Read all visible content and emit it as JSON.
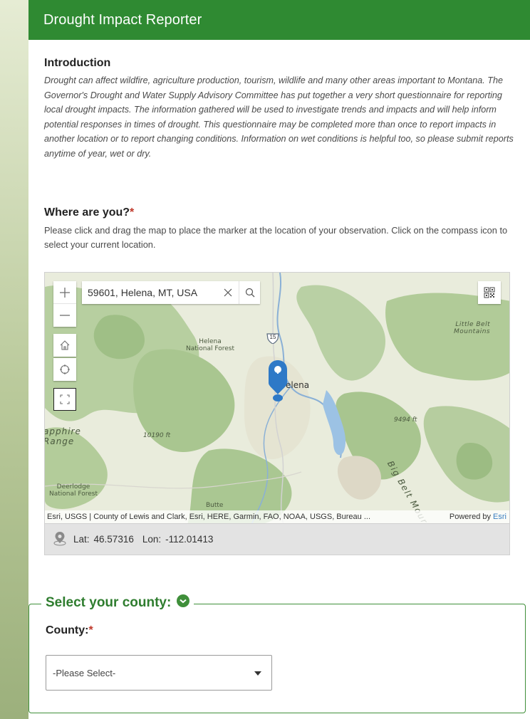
{
  "header": {
    "title": "Drought Impact Reporter",
    "bg_color": "#2f8a32"
  },
  "introduction": {
    "heading": "Introduction",
    "body": "Drought can affect wildfire, agriculture production, tourism, wildlife and many other areas important to Montana. The Governor's Drought and Water Supply Advisory Committee has put together a very short questionnaire for reporting local drought impacts. The information gathered will be used to investigate trends and impacts and will help inform potential responses in times of drought. This questionnaire may be completed more than once to report impacts in another location or to report changing conditions. Information on wet conditions is helpful too, so please submit reports anytime of year, wet or dry."
  },
  "location": {
    "heading": "Where are you?",
    "required_mark": "*",
    "instructions": "Please click and drag the map to place the marker at the location of your observation. Click on the compass icon to select your current location."
  },
  "map": {
    "search_value": "59601, Helena, MT, USA",
    "labels": {
      "helena_nf": "Helena\nNational Forest",
      "helena_nf_line1": "Helena",
      "helena_nf_line2": "National Forest",
      "little_belt_line1": "Little Belt",
      "little_belt_line2": "Mountains",
      "city": "elena",
      "elev1": "9494 ft",
      "elev2": "10190 ft",
      "sapphire_line1": "apphire",
      "sapphire_line2": "Range",
      "big_belt": "Big Belt Mour",
      "deerlodge_line1": "Deerlodge",
      "deerlodge_line2": "National Forest",
      "butte": "Butte",
      "interstate": "15"
    },
    "attribution": "Esri, USGS | County of Lewis and Clark, Esri, HERE, Garmin, FAO, NOAA, USGS, Bureau ...",
    "powered_prefix": "Powered by ",
    "powered_link": "Esri",
    "coords": {
      "lat_label": "Lat:",
      "lat": "46.57316",
      "lon_label": "Lon:",
      "lon": "-112.01413"
    },
    "tools": [
      "zoom-in",
      "zoom-out",
      "home",
      "locate",
      "fullscreen"
    ]
  },
  "county_section": {
    "legend": "Select your county:",
    "field_label": "County:",
    "required_mark": "*",
    "select_value": "-Please Select-"
  },
  "colors": {
    "accent": "#2f8a32",
    "required": "#c0392b",
    "marker": "#2e79c7"
  }
}
